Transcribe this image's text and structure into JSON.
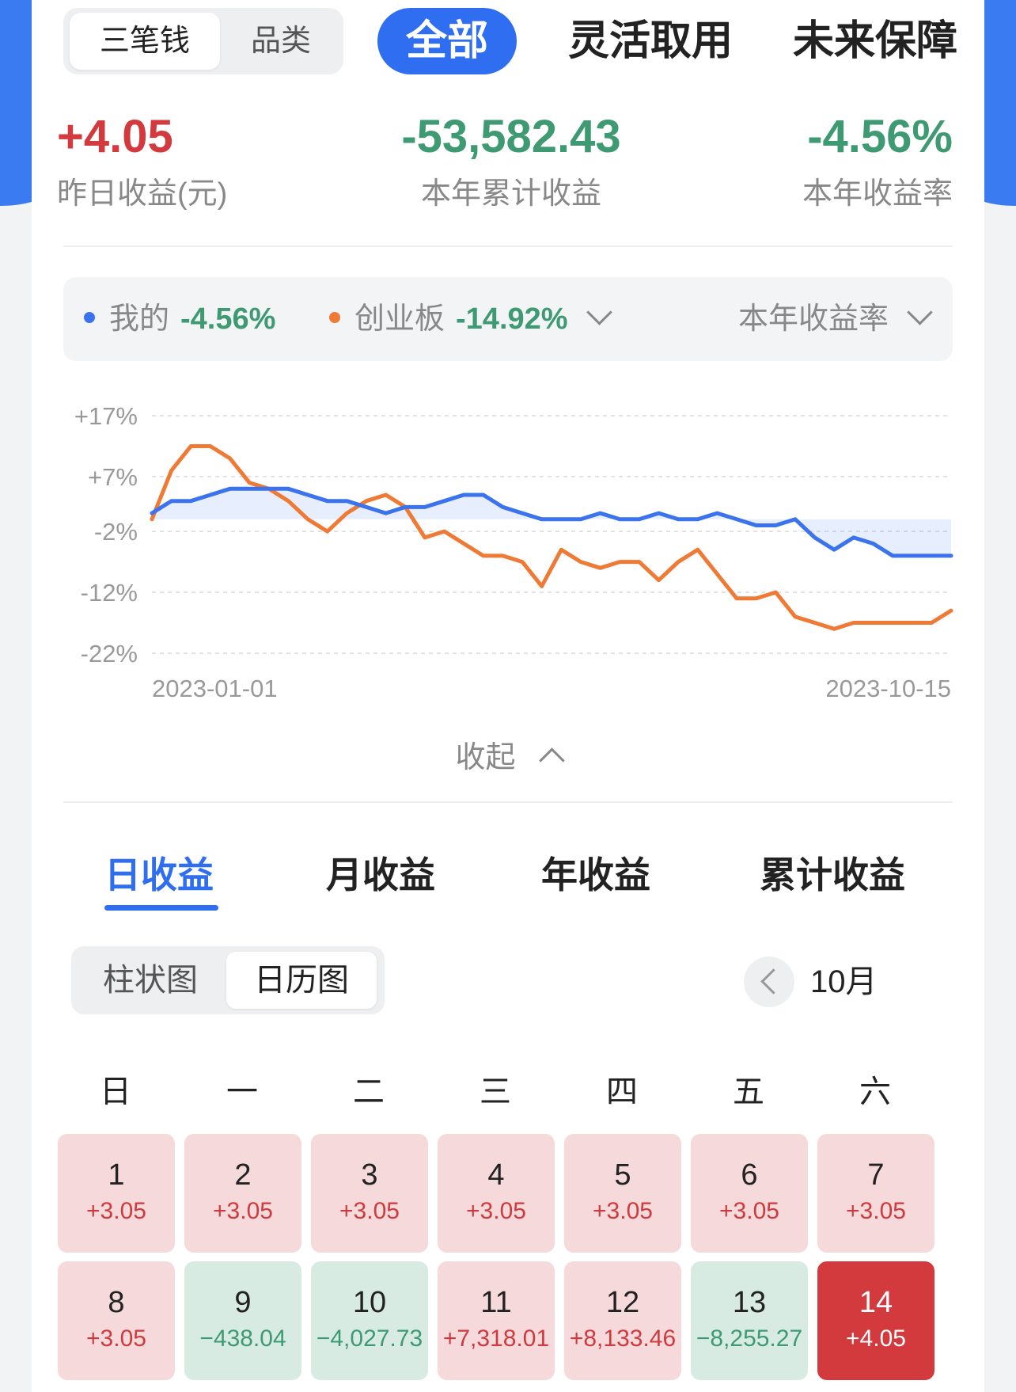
{
  "segment": {
    "options": [
      "三笔钱",
      "品类"
    ],
    "active": 0
  },
  "top_tabs": [
    "全部",
    "灵活取用",
    "未来保障"
  ],
  "stats": [
    {
      "value": "+4.05",
      "label": "昨日收益(元)"
    },
    {
      "value": "-53,582.43",
      "label": "本年累计收益"
    },
    {
      "value": "-4.56%",
      "label": "本年收益率"
    }
  ],
  "legend": {
    "mine_label": "我的",
    "mine_value": "-4.56%",
    "bench_label": "创业板",
    "bench_value": "-14.92%",
    "metric": "本年收益率"
  },
  "colors": {
    "mine": "#3b73ee",
    "bench": "#ee7a35",
    "accent": "#2f6ef0",
    "up": "#d23a3e",
    "down": "#3e9a72"
  },
  "chart_data": {
    "type": "line",
    "y_ticks": [
      "+17%",
      "+7%",
      "-2%",
      "-12%",
      "-22%"
    ],
    "y_tick_values": [
      17,
      7,
      -2,
      -12,
      -22
    ],
    "ylim": [
      -22,
      17
    ],
    "x_tick_labels": [
      "2023-01-01",
      "2023-10-15"
    ],
    "x": [
      "2023-01-01",
      "2023-01-08",
      "2023-01-15",
      "2023-01-22",
      "2023-01-29",
      "2023-02-05",
      "2023-02-12",
      "2023-02-19",
      "2023-02-26",
      "2023-03-05",
      "2023-03-12",
      "2023-03-19",
      "2023-03-26",
      "2023-04-02",
      "2023-04-09",
      "2023-04-16",
      "2023-04-23",
      "2023-04-30",
      "2023-05-07",
      "2023-05-14",
      "2023-05-21",
      "2023-05-28",
      "2023-06-04",
      "2023-06-11",
      "2023-06-18",
      "2023-06-25",
      "2023-07-02",
      "2023-07-09",
      "2023-07-16",
      "2023-07-23",
      "2023-07-30",
      "2023-08-06",
      "2023-08-13",
      "2023-08-20",
      "2023-08-27",
      "2023-09-03",
      "2023-09-10",
      "2023-09-17",
      "2023-09-24",
      "2023-10-01",
      "2023-10-08",
      "2023-10-15"
    ],
    "series": [
      {
        "name": "我的",
        "values": [
          1,
          3,
          3,
          4,
          5,
          5,
          5,
          5,
          4,
          3,
          3,
          2,
          1,
          2,
          2,
          3,
          4,
          4,
          2,
          1,
          0,
          0,
          0,
          1,
          0,
          0,
          1,
          0,
          0,
          1,
          0,
          -1,
          -1,
          0,
          -3,
          -5,
          -3,
          -4,
          -6,
          -6,
          -6,
          -6
        ]
      },
      {
        "name": "创业板",
        "values": [
          0,
          8,
          12,
          12,
          10,
          6,
          5,
          3,
          0,
          -2,
          1,
          3,
          4,
          2,
          -3,
          -2,
          -4,
          -6,
          -6,
          -7,
          -11,
          -5,
          -7,
          -8,
          -7,
          -7,
          -10,
          -7,
          -5,
          -9,
          -13,
          -13,
          -12,
          -16,
          -17,
          -18,
          -17,
          -17,
          -17,
          -17,
          -17,
          -15
        ]
      }
    ],
    "fill_series": "我的",
    "grid": true
  },
  "collapse_label": "收起",
  "period_tabs": [
    "日收益",
    "月收益",
    "年收益",
    "累计收益"
  ],
  "view_toggle": [
    "柱状图",
    "日历图"
  ],
  "month_label": "10月",
  "weekdays": [
    "日",
    "一",
    "二",
    "三",
    "四",
    "五",
    "六"
  ],
  "calendar": [
    {
      "day": "1",
      "value": "+3.05",
      "state": "pos"
    },
    {
      "day": "2",
      "value": "+3.05",
      "state": "pos"
    },
    {
      "day": "3",
      "value": "+3.05",
      "state": "pos"
    },
    {
      "day": "4",
      "value": "+3.05",
      "state": "pos"
    },
    {
      "day": "5",
      "value": "+3.05",
      "state": "pos"
    },
    {
      "day": "6",
      "value": "+3.05",
      "state": "pos"
    },
    {
      "day": "7",
      "value": "+3.05",
      "state": "pos"
    },
    {
      "day": "8",
      "value": "+3.05",
      "state": "pos"
    },
    {
      "day": "9",
      "value": "−438.04",
      "state": "neg"
    },
    {
      "day": "10",
      "value": "−4,027.73",
      "state": "neg"
    },
    {
      "day": "11",
      "value": "+7,318.01",
      "state": "pos"
    },
    {
      "day": "12",
      "value": "+8,133.46",
      "state": "pos"
    },
    {
      "day": "13",
      "value": "−8,255.27",
      "state": "neg"
    },
    {
      "day": "14",
      "value": "+4.05",
      "state": "today"
    }
  ]
}
